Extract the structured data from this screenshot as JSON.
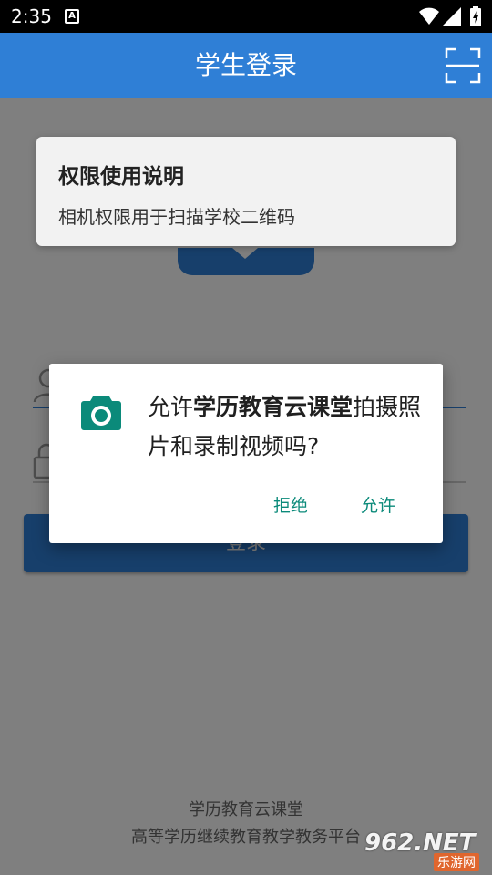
{
  "status_bar": {
    "time": "2:35",
    "notification_letter": "A",
    "icons": [
      "wifi-icon",
      "signal-icon",
      "battery-icon"
    ]
  },
  "app_bar": {
    "title": "学生登录",
    "scan_icon": "scan-icon"
  },
  "login": {
    "user_icon": "user-icon",
    "lock_icon": "lock-icon",
    "login_button_label": "登录"
  },
  "footer": {
    "line1": "学历教育云课堂",
    "line2": "高等学历继续教育教学教务平台"
  },
  "permission_card": {
    "title": "权限使用说明",
    "description": "相机权限用于扫描学校二维码"
  },
  "permission_dialog": {
    "icon": "camera-icon",
    "prefix": "允许",
    "app_name": "学历教育云课堂",
    "suffix": "拍摄照片和录制视频吗?",
    "deny_label": "拒绝",
    "allow_label": "允许"
  },
  "watermark": {
    "main": "962.NET",
    "sub": "乐游网"
  },
  "colors": {
    "primary": "#2f7fd6",
    "dialog_accent": "#0b8a7a",
    "card_bg": "#f2f2f2"
  }
}
